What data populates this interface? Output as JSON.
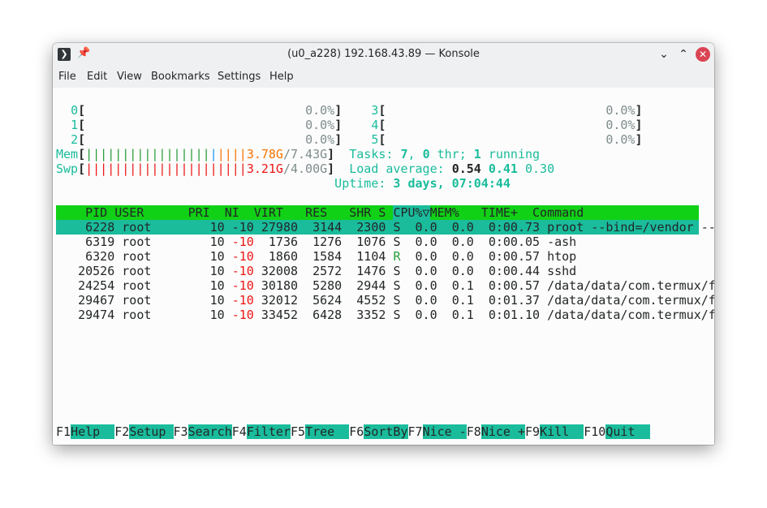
{
  "window": {
    "title": "(u0_a228) 192.168.43.89 — Konsole"
  },
  "menu": [
    "File",
    "Edit",
    "View",
    "Bookmarks",
    "Settings",
    "Help"
  ],
  "cpus": [
    {
      "id": "0",
      "pct": "0.0%"
    },
    {
      "id": "1",
      "pct": "0.0%"
    },
    {
      "id": "2",
      "pct": "0.0%"
    },
    {
      "id": "3",
      "pct": "0.0%"
    },
    {
      "id": "4",
      "pct": "0.0%"
    },
    {
      "id": "5",
      "pct": "0.0%"
    }
  ],
  "mem": {
    "label": "Mem",
    "used": "3.78G",
    "total": "7.43G"
  },
  "swp": {
    "label": "Swp",
    "used": "3.21G",
    "total": "4.00G"
  },
  "tasks": {
    "label": "Tasks:",
    "count": "7",
    "thr": "0",
    "thr_label": "thr;",
    "running": "1",
    "running_label": "running"
  },
  "load": {
    "label": "Load average:",
    "l1": "0.54",
    "l5": "0.41",
    "l15": "0.30"
  },
  "uptime": {
    "label": "Uptime:",
    "value": "3 days, 07:04:44"
  },
  "table": {
    "headers": {
      "pid": "PID",
      "user": "USER",
      "pri": "PRI",
      "ni": "NI",
      "virt": "VIRT",
      "res": "RES",
      "shr": "SHR",
      "s": "S",
      "cpu": "CPU%▽",
      "mem": "MEM%",
      "time": "TIME+",
      "cmd": "Command"
    },
    "rows": [
      {
        "pid": "6228",
        "user": "root",
        "pri": "10",
        "ni": "-10",
        "virt": "27980",
        "res": "3144",
        "shr": "2300",
        "s": "S",
        "cpu": "0.0",
        "mem": "0.0",
        "time": "0:00.73",
        "cmd": "proot --bind=/vendor --"
      },
      {
        "pid": "6319",
        "user": "root",
        "pri": "10",
        "ni": "-10",
        "virt": "1736",
        "res": "1276",
        "shr": "1076",
        "s": "S",
        "cpu": "0.0",
        "mem": "0.0",
        "time": "0:00.05",
        "cmd": "-ash"
      },
      {
        "pid": "6320",
        "user": "root",
        "pri": "10",
        "ni": "-10",
        "virt": "1860",
        "res": "1584",
        "shr": "1104",
        "s": "R",
        "cpu": "0.0",
        "mem": "0.0",
        "time": "0:00.57",
        "cmd": "htop"
      },
      {
        "pid": "20526",
        "user": "root",
        "pri": "10",
        "ni": "-10",
        "virt": "32008",
        "res": "2572",
        "shr": "1476",
        "s": "S",
        "cpu": "0.0",
        "mem": "0.0",
        "time": "0:00.44",
        "cmd": "sshd"
      },
      {
        "pid": "24254",
        "user": "root",
        "pri": "10",
        "ni": "-10",
        "virt": "30180",
        "res": "5280",
        "shr": "2944",
        "s": "S",
        "cpu": "0.0",
        "mem": "0.1",
        "time": "0:00.57",
        "cmd": "/data/data/com.termux/f"
      },
      {
        "pid": "29467",
        "user": "root",
        "pri": "10",
        "ni": "-10",
        "virt": "32012",
        "res": "5624",
        "shr": "4552",
        "s": "S",
        "cpu": "0.0",
        "mem": "0.1",
        "time": "0:01.37",
        "cmd": "/data/data/com.termux/f"
      },
      {
        "pid": "29474",
        "user": "root",
        "pri": "10",
        "ni": "-10",
        "virt": "33452",
        "res": "6428",
        "shr": "3352",
        "s": "S",
        "cpu": "0.0",
        "mem": "0.1",
        "time": "0:01.10",
        "cmd": "/data/data/com.termux/f"
      }
    ]
  },
  "fkeys": [
    {
      "key": "F1",
      "label": "Help  "
    },
    {
      "key": "F2",
      "label": "Setup "
    },
    {
      "key": "F3",
      "label": "Search"
    },
    {
      "key": "F4",
      "label": "Filter"
    },
    {
      "key": "F5",
      "label": "Tree  "
    },
    {
      "key": "F6",
      "label": "SortBy"
    },
    {
      "key": "F7",
      "label": "Nice -"
    },
    {
      "key": "F8",
      "label": "Nice +"
    },
    {
      "key": "F9",
      "label": "Kill  "
    },
    {
      "key": "F10",
      "label": "Quit  "
    }
  ],
  "colors": {
    "accent": "#1abc9c",
    "header_green": "#11d116",
    "close_red": "#da4453",
    "nice_red": "#ed1515"
  }
}
